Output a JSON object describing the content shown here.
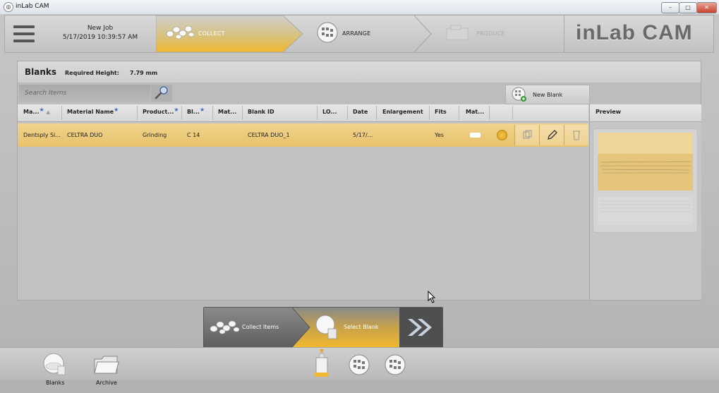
{
  "window": {
    "title": "inLab CAM",
    "controls": {
      "minimize": "–",
      "maximize": "□",
      "close": "✕"
    }
  },
  "header": {
    "job_name": "New Job",
    "job_date": "5/17/2019 10:39:57 AM",
    "steps": [
      {
        "label": "COLLECT",
        "state": "active"
      },
      {
        "label": "ARRANGE",
        "state": "normal"
      },
      {
        "label": "PRODUCE",
        "state": "disabled"
      }
    ],
    "brand": "inLab CAM"
  },
  "blanks_panel": {
    "title": "Blanks",
    "required_height_label": "Required Height:",
    "required_height_value": "7.79 mm",
    "search_placeholder": "Search Items",
    "new_blank_label": "New Blank",
    "columns": [
      "Ma...",
      "Material Name",
      "Product...",
      "Bl...",
      "Mat...",
      "Blank ID",
      "LO...",
      "Date",
      "Enlargement",
      "Fits",
      "Mat..."
    ],
    "preview_header": "Preview",
    "rows": [
      {
        "manufacturer": "Dentsply Si...",
        "material_name": "CELTRA DUO",
        "production": "Grinding",
        "block": "C 14",
        "material_type": "",
        "blank_id": "CELTRA DUO_1",
        "lot": "",
        "date": "5/17/...",
        "enlargement": "",
        "fits": "Yes"
      }
    ]
  },
  "wizard": {
    "collect_items": "Collect Items",
    "select_blank": "Select Blank"
  },
  "bottom_bar": {
    "blanks_label": "Blanks",
    "archive_label": "Archive"
  },
  "colors": {
    "accent": "#e8c26c",
    "selection": "#f0d38c",
    "brand_text": "#6a6a6a"
  }
}
